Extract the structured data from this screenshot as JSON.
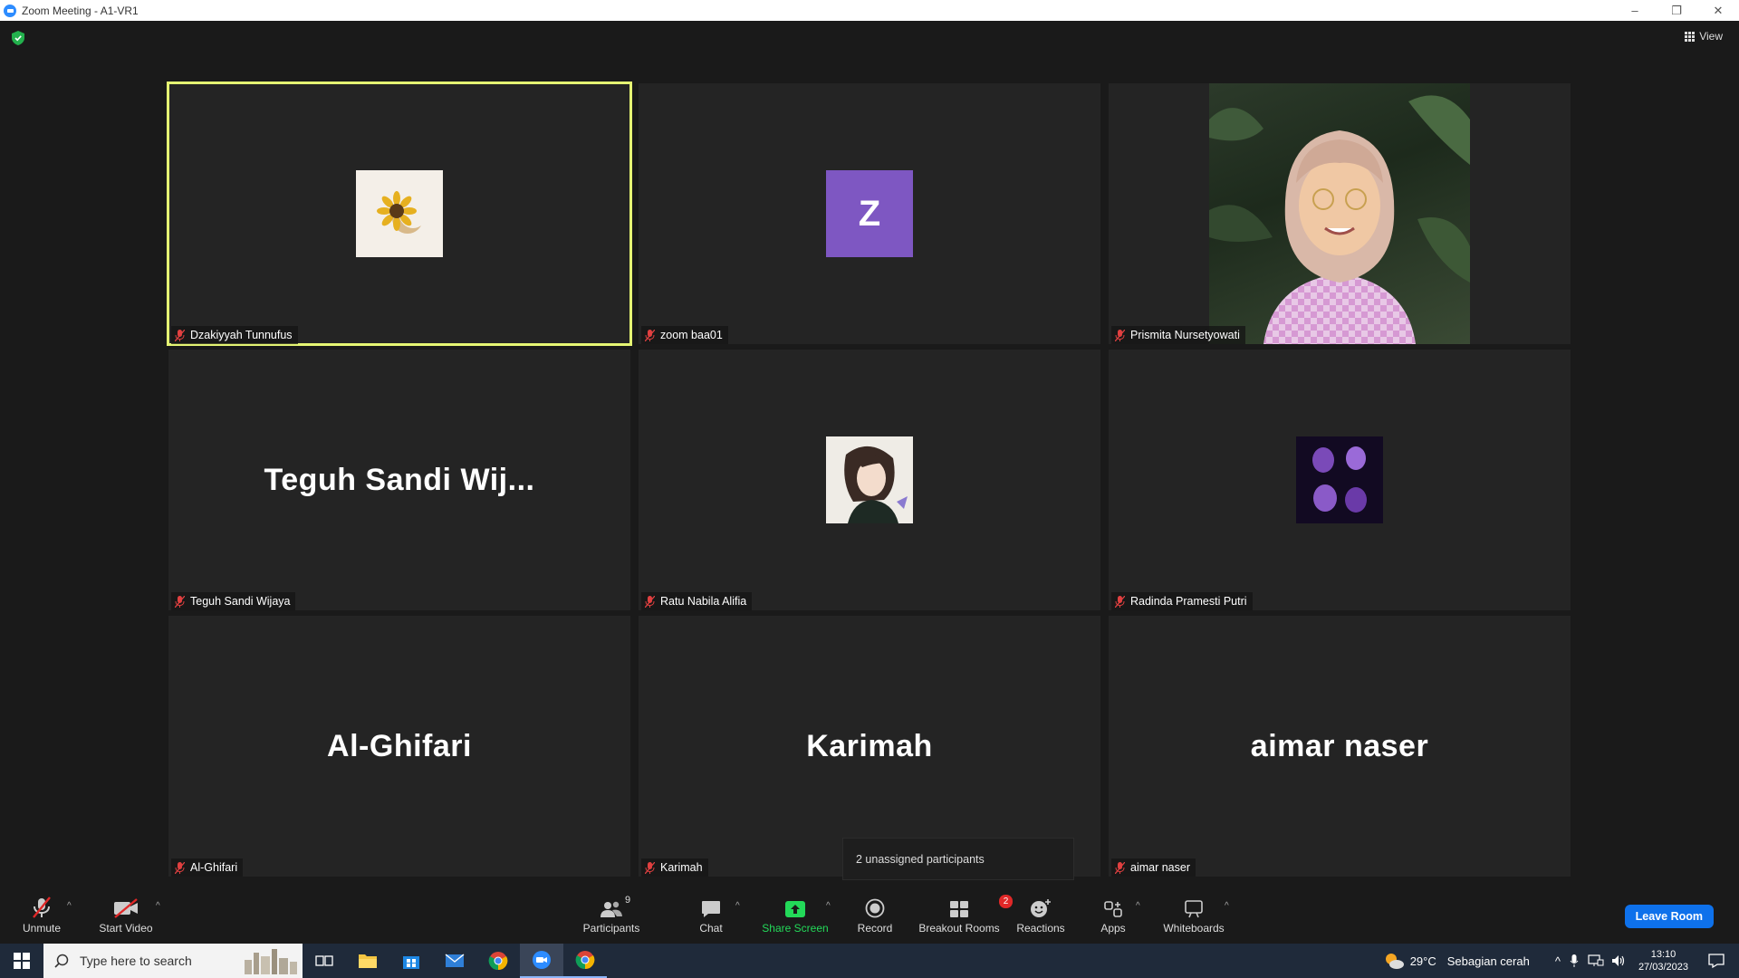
{
  "window": {
    "title": "Zoom Meeting - A1-VR1",
    "controls": [
      "–",
      "❐",
      "✕"
    ]
  },
  "header": {
    "view_label": "View"
  },
  "participants_tiles": [
    {
      "name": "Dzakiyyah Tunnufus",
      "display": "avatar-sunflower",
      "active": true
    },
    {
      "name": "zoom baa01",
      "display": "initial",
      "initial": "Z",
      "avatar_color": "#7e57c2"
    },
    {
      "name": "Prismita Nursetyowati",
      "display": "video"
    },
    {
      "name": "Teguh Sandi Wijaya",
      "display": "name",
      "big_name": "Teguh Sandi Wij..."
    },
    {
      "name": "Ratu Nabila Alifia",
      "display": "avatar-illustration"
    },
    {
      "name": "Radinda Pramesti Putri",
      "display": "avatar-purple"
    },
    {
      "name": "Al-Ghifari",
      "display": "name",
      "big_name": "Al-Ghifari"
    },
    {
      "name": "Karimah",
      "display": "name",
      "big_name": "Karimah"
    },
    {
      "name": "aimar naser",
      "display": "name",
      "big_name": "aimar naser"
    }
  ],
  "tooltip": {
    "text": "2 unassigned participants"
  },
  "toolbar": {
    "unmute": "Unmute",
    "start_video": "Start Video",
    "participants": "Participants",
    "participants_count": "9",
    "chat": "Chat",
    "share_screen": "Share Screen",
    "record": "Record",
    "breakout_rooms": "Breakout Rooms",
    "breakout_badge": "2",
    "reactions": "Reactions",
    "apps": "Apps",
    "whiteboards": "Whiteboards",
    "leave": "Leave Room"
  },
  "taskbar": {
    "search_placeholder": "Type here to search",
    "weather_temp": "29°C",
    "weather_text": "Sebagian cerah",
    "time": "13:10",
    "date": "27/03/2023"
  },
  "colors": {
    "active_speaker": "#e5f573",
    "leave": "#0e71eb",
    "share": "#23d959",
    "badge": "#e02828"
  }
}
